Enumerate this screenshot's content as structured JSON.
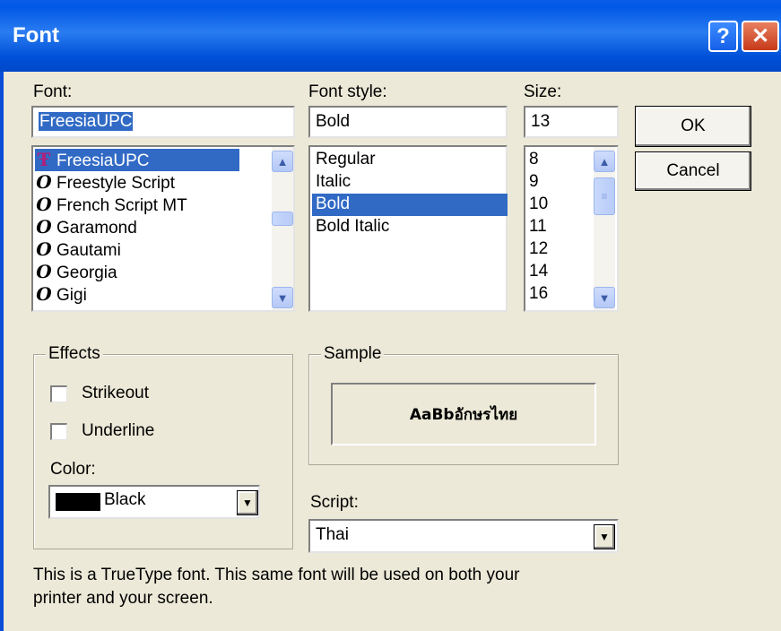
{
  "window": {
    "title": "Font",
    "help_button": "?",
    "close_button": "✕"
  },
  "font": {
    "label": "Font:",
    "value": "FreesiaUPC",
    "items": [
      {
        "name": "FreesiaUPC",
        "icon": "truetype-font-icon",
        "selected": true
      },
      {
        "name": "Freestyle Script",
        "icon": "opentype-font-icon"
      },
      {
        "name": "French Script MT",
        "icon": "opentype-font-icon"
      },
      {
        "name": "Garamond",
        "icon": "opentype-font-icon"
      },
      {
        "name": "Gautami",
        "icon": "opentype-font-icon"
      },
      {
        "name": "Georgia",
        "icon": "opentype-font-icon"
      },
      {
        "name": "Gigi",
        "icon": "opentype-font-icon"
      }
    ]
  },
  "style": {
    "label": "Font style:",
    "value": "Bold",
    "items": [
      "Regular",
      "Italic",
      "Bold",
      "Bold Italic"
    ],
    "selected_index": 2
  },
  "size": {
    "label": "Size:",
    "value": "13",
    "items": [
      "8",
      "9",
      "10",
      "11",
      "12",
      "14",
      "16"
    ]
  },
  "buttons": {
    "ok": "OK",
    "cancel": "Cancel"
  },
  "effects": {
    "title": "Effects",
    "strikeout": "Strikeout",
    "underline": "Underline",
    "strikeout_checked": false,
    "underline_checked": false,
    "color_label": "Color:",
    "color_value": "Black",
    "color_swatch": "#000000"
  },
  "sample": {
    "title": "Sample",
    "text": "AaBbอักษรไทย"
  },
  "script": {
    "label": "Script:",
    "value": "Thai"
  },
  "info": {
    "line1": "This is a TrueType font. This same font will be used on both your",
    "line2": "printer and your screen."
  },
  "icons": {
    "scroll_up": "▲",
    "scroll_down": "▼",
    "combo_arrow": "▼",
    "thumb_grip": "≡"
  },
  "colors": {
    "selection": "#316ac5",
    "titlebar": "#0058e6"
  }
}
